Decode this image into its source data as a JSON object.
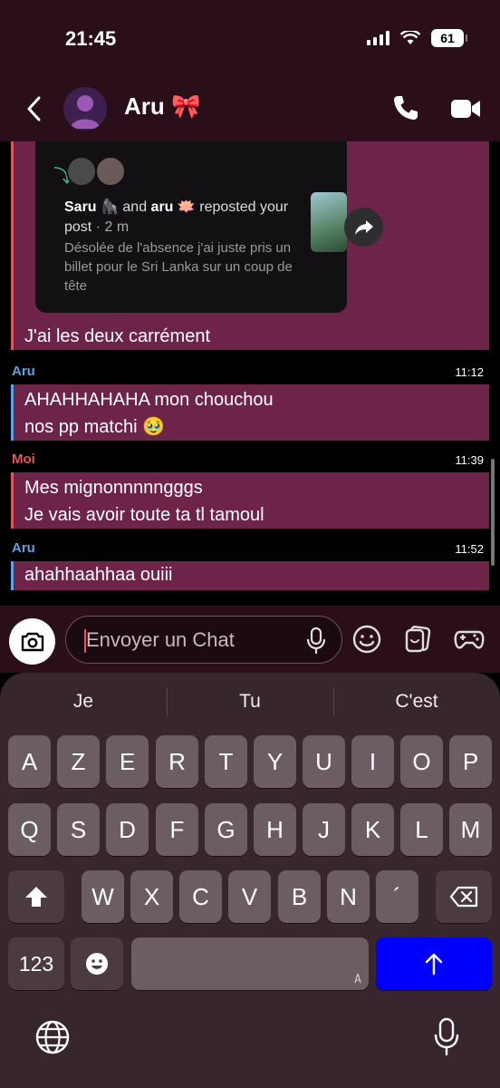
{
  "status_bar": {
    "time": "21:45",
    "battery": "61"
  },
  "header": {
    "contact_name": "Aru 🎀"
  },
  "story_reply": {
    "repost_user1": "Saru 🦍",
    "repost_and": "and",
    "repost_user2": "aru 🪷",
    "repost_action": "reposted your post",
    "repost_time": "· 2 m",
    "story_text": "Désolée de l'absence j'ai juste pris un billet pour le Sri Lanka sur un coup de tête"
  },
  "messages": [
    {
      "sender": "",
      "time": "",
      "lines": [
        "J'ai les deux carrément"
      ]
    },
    {
      "sender": "Aru",
      "time": "11:12",
      "lines": [
        "AHAHHAHAHA mon chouchou",
        "nos pp matchi 🥹"
      ]
    },
    {
      "sender": "Moi",
      "time": "11:39",
      "lines": [
        "Mes mignonnnnngggs",
        "Je vais avoir toute ta tl tamoul"
      ]
    },
    {
      "sender": "Aru",
      "time": "11:52",
      "lines": [
        "ahahhaahhaa ouiii"
      ]
    }
  ],
  "composer": {
    "placeholder": "Envoyer un Chat"
  },
  "keyboard": {
    "suggestions": [
      "Je",
      "Tu",
      "C'est"
    ],
    "row1": [
      "A",
      "Z",
      "E",
      "R",
      "T",
      "Y",
      "U",
      "I",
      "O",
      "P"
    ],
    "row2": [
      "Q",
      "S",
      "D",
      "F",
      "G",
      "H",
      "J",
      "K",
      "L",
      "M"
    ],
    "row3": [
      "W",
      "X",
      "C",
      "V",
      "B",
      "N",
      "´"
    ],
    "numbers_key": "123",
    "space_hint": "A"
  },
  "colors": {
    "accent": "#6e2448",
    "aru": "#5aa3e6",
    "moi": "#e0565b",
    "send_key": "#0000ff"
  }
}
